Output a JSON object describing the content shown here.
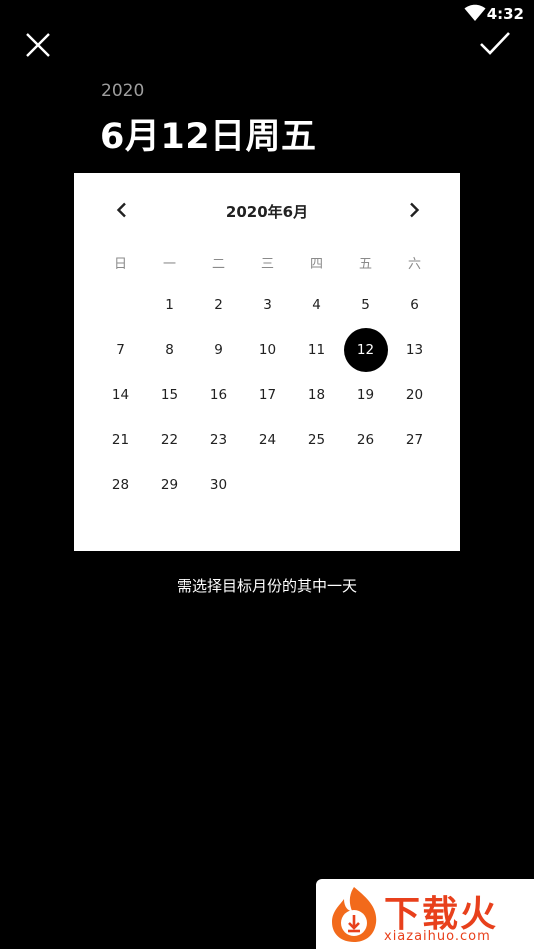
{
  "status_bar": {
    "time": "4:32",
    "icons": [
      "wifi-icon"
    ]
  },
  "toolbar": {
    "close_icon": "close-icon",
    "confirm_icon": "check-icon"
  },
  "header": {
    "year": "2020",
    "selected_date": "6月12日周五"
  },
  "calendar": {
    "month_label": "2020年6月",
    "prev_icon": "chevron-left-icon",
    "next_icon": "chevron-right-icon",
    "weekdays": [
      "日",
      "一",
      "二",
      "三",
      "四",
      "五",
      "六"
    ],
    "days": [
      "",
      "1",
      "2",
      "3",
      "4",
      "5",
      "6",
      "7",
      "8",
      "9",
      "10",
      "11",
      "12",
      "13",
      "14",
      "15",
      "16",
      "17",
      "18",
      "19",
      "20",
      "21",
      "22",
      "23",
      "24",
      "25",
      "26",
      "27",
      "28",
      "29",
      "30"
    ],
    "selected_day": "12",
    "selected_color": "#000000"
  },
  "hint": "需选择目标月份的其中一天",
  "watermark": {
    "brand": "下载火",
    "url": "xiazaihuo.com",
    "color": "#e8401c"
  }
}
